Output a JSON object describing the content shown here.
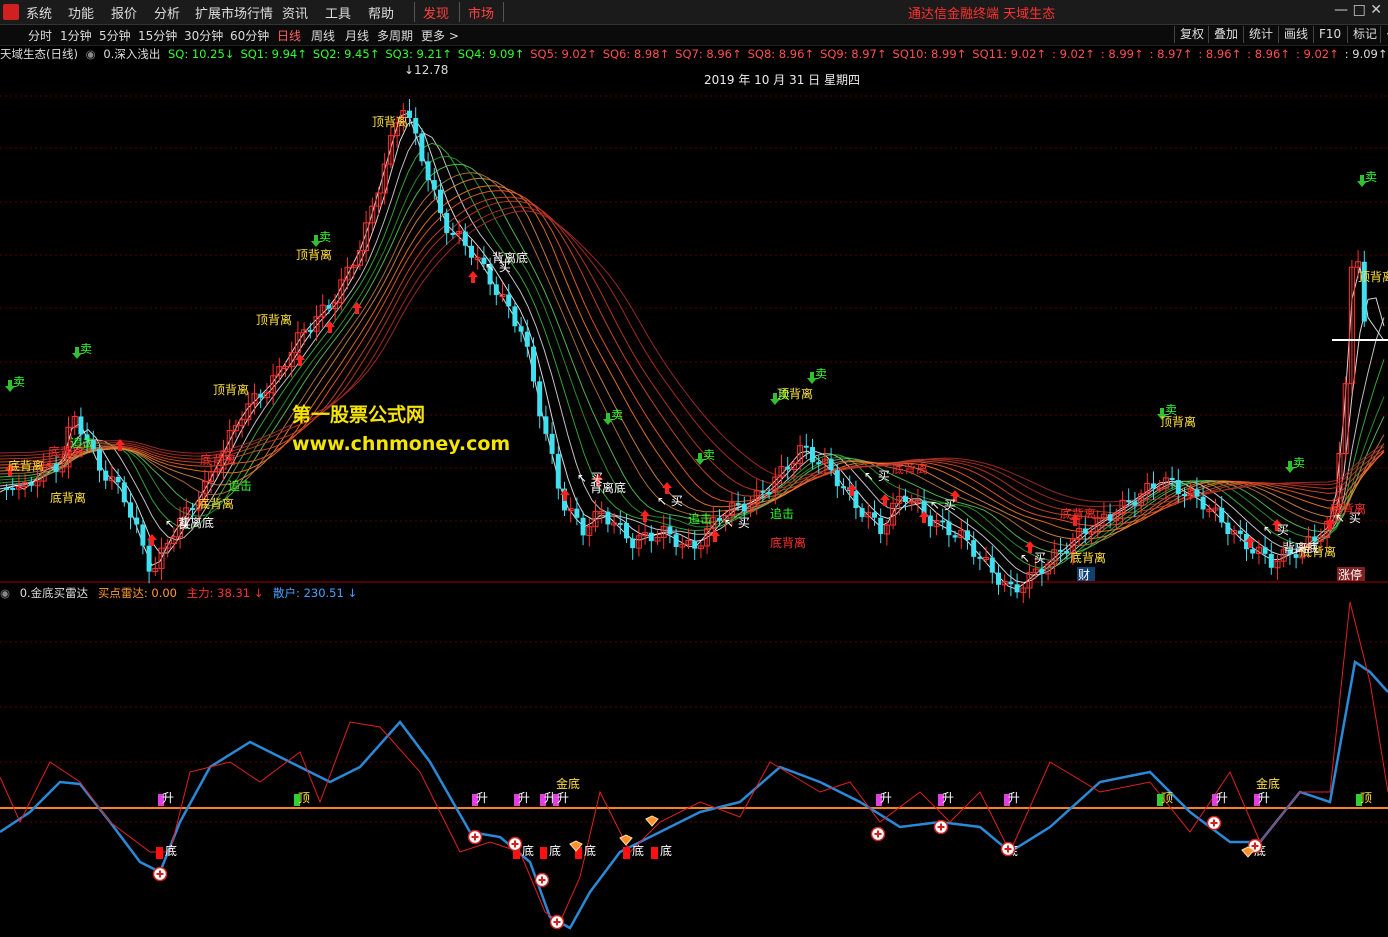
{
  "menu": {
    "items": [
      "系统",
      "功能",
      "报价",
      "分析",
      "扩展市场行情",
      "资讯",
      "工具",
      "帮助"
    ],
    "discover": "发现",
    "market": "市场",
    "brand": "通达信金融终端  天域生态",
    "window_controls": "— □ ✕"
  },
  "periods": {
    "items": [
      "分时",
      "1分钟",
      "5分钟",
      "15分钟",
      "30分钟",
      "60分钟",
      "日线",
      "周线",
      "月线",
      "多周期",
      "更多 >"
    ],
    "active": "日线"
  },
  "tools": [
    "复权",
    "叠加",
    "统计",
    "画线",
    "F10",
    "标记",
    "·"
  ],
  "main_legend": {
    "stock": "天域生态(日线)",
    "indicator": "0.深入浅出",
    "values": [
      {
        "t": "SQ: 10.25↓",
        "c": "#30ff30"
      },
      {
        "t": "SQ1: 9.94↑",
        "c": "#30ff30"
      },
      {
        "t": "SQ2: 9.45↑",
        "c": "#30ff30"
      },
      {
        "t": "SQ3: 9.21↑",
        "c": "#30ff30"
      },
      {
        "t": "SQ4: 9.09↑",
        "c": "#30ff30"
      },
      {
        "t": "SQ5: 9.02↑",
        "c": "#ff5050"
      },
      {
        "t": "SQ6: 8.98↑",
        "c": "#ff5050"
      },
      {
        "t": "SQ7: 8.96↑",
        "c": "#ff5050"
      },
      {
        "t": "SQ8: 8.96↑",
        "c": "#ff5050"
      },
      {
        "t": "SQ9: 8.97↑",
        "c": "#ff5050"
      },
      {
        "t": "SQ10: 8.99↑",
        "c": "#ff5050"
      },
      {
        "t": "SQ11: 9.02↑",
        "c": "#ff5050"
      },
      {
        "t": ": 9.02↑",
        "c": "#ff5050"
      },
      {
        "t": ": 8.99↑",
        "c": "#ff5050"
      },
      {
        "t": ": 8.97↑",
        "c": "#ff5050"
      },
      {
        "t": ": 8.96↑",
        "c": "#ff5050"
      },
      {
        "t": ": 8.96↑",
        "c": "#ff5050"
      },
      {
        "t": ": 9.02↑",
        "c": "#ff5050"
      },
      {
        "t": ": 9.09↑",
        "c": "#dddddd"
      }
    ]
  },
  "chart_date": "2019 年 10 月 31 日 星期四",
  "high_label": "12.78",
  "watermark": {
    "line1": "第一股票公式网",
    "line2": "www.chnmoney.com"
  },
  "sub_legend": {
    "indicator": "0.金底买雷达",
    "buy_radar": "买点雷达: 0.00",
    "main_force": "主力: 38.31 ↓",
    "retail": "散户: 230.51 ↓"
  },
  "signals": {
    "sell": "卖",
    "buy": "买",
    "top_div": "顶背离",
    "bottom_div": "底背离",
    "div_bottom": "背离底",
    "chase": "追击",
    "rise": "升",
    "top": "顶",
    "bottom": "底",
    "gold_bottom": "金底",
    "finance": "财",
    "limit": "涨停"
  },
  "colors": {
    "up": "#ff3030",
    "down": "#40e0f0",
    "base": "#ff8020",
    "blue": "#2a8ad8"
  }
}
